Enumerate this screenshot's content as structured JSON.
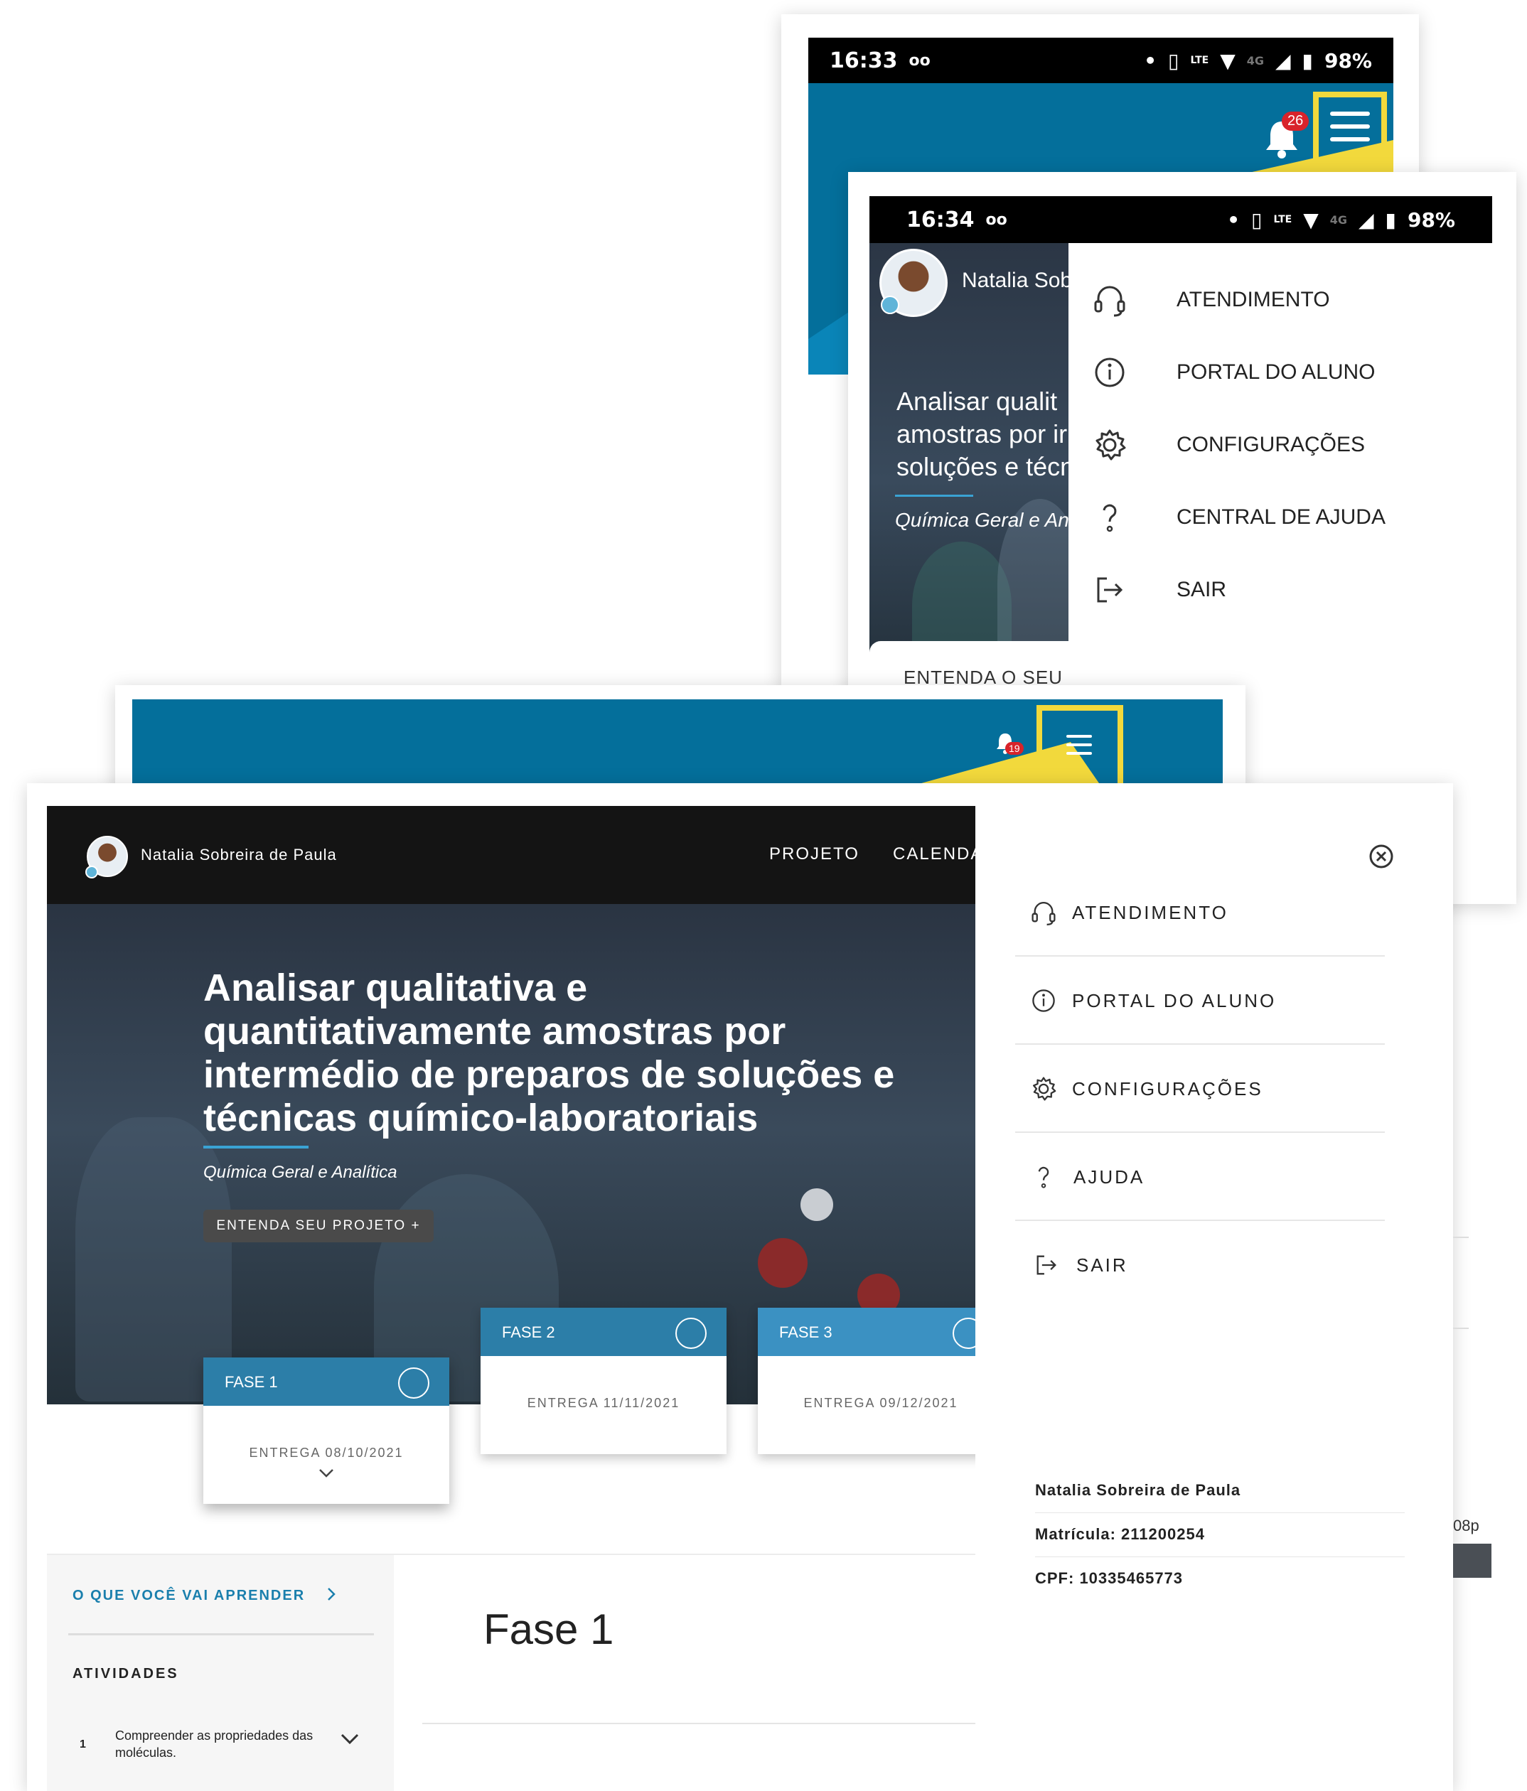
{
  "phone1": {
    "time": "16:33",
    "voicemail": "oo",
    "battery": "98%",
    "network": "4G",
    "notification_count": "26"
  },
  "phone2": {
    "time": "16:34",
    "voicemail": "oo",
    "battery": "98%",
    "network": "4G",
    "user_name": "Natalia Sob",
    "hero_title": "Analisar qualit\namostras por ir\nsoluções e técn",
    "hero_subtitle": "Química Geral e An",
    "cta_label": "ENTENDA O SEU",
    "menu": [
      "ATENDIMENTO",
      "PORTAL DO ALUNO",
      "CONFIGURAÇÕES",
      "CENTRAL DE AJUDA",
      "SAIR"
    ]
  },
  "desktop_top": {
    "notification_count": "19"
  },
  "desktop": {
    "user_name": "Natalia Sobreira de Paula",
    "nav": [
      "PROJETO",
      "CALENDA"
    ],
    "hero_title": "Analisar qualitativa e quantitativamente amostras por intermédio de preparos de soluções e técnicas químico-laboratoriais",
    "hero_subtitle": "Química Geral e Analítica",
    "cta_label": "ENTENDA SEU PROJETO +",
    "phases": [
      {
        "label": "FASE 1",
        "delivery": "ENTREGA 08/10/2021"
      },
      {
        "label": "FASE 2",
        "delivery": "ENTREGA 11/11/2021"
      },
      {
        "label": "FASE 3",
        "delivery": "ENTREGA 09/12/2021"
      }
    ],
    "learn_link": "O QUE VOCÊ VAI APRENDER",
    "activities_heading": "ATIVIDADES",
    "activity_number": "1",
    "activity_text": "Compreender as propriedades das moléculas.",
    "section_title": "Fase 1",
    "menu": [
      "ATENDIMENTO",
      "PORTAL DO ALUNO",
      "CONFIGURAÇÕES",
      "AJUDA",
      "SAIR"
    ],
    "user_info": {
      "name": "Natalia Sobreira de Paula",
      "matricula": "Matrícula: 211200254",
      "cpf": "CPF: 10335465773"
    },
    "peek_text": "08p"
  },
  "colors": {
    "brand_blue": "#046f9b",
    "highlight": "#f2d93c",
    "phase_blue": "#2c7ea8",
    "link_blue": "#1a7fad"
  }
}
